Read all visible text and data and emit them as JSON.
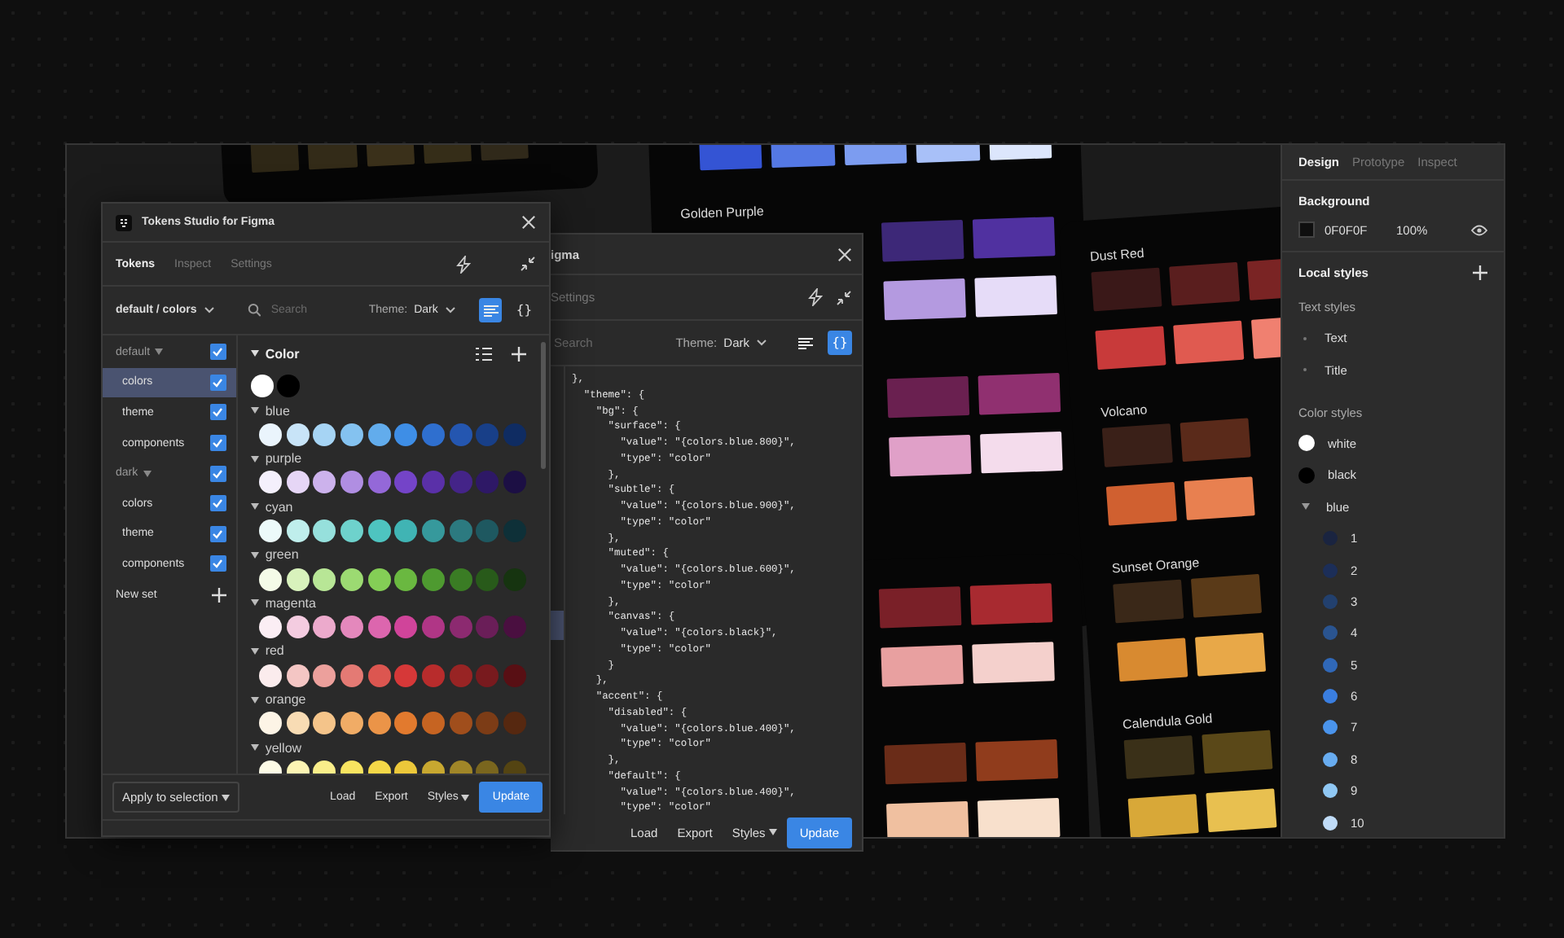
{
  "plugin": {
    "title": "Tokens Studio for Figma",
    "tabs": [
      {
        "label": "Tokens",
        "selected": true
      },
      {
        "label": "Inspect",
        "selected": false
      },
      {
        "label": "Settings",
        "selected": false
      }
    ],
    "set_picker": "default / colors",
    "search": {
      "placeholder": "Search"
    },
    "theme_label": "Theme:",
    "theme_value": "Dark",
    "view_buttons": [
      {
        "kind": "list",
        "selected": true
      },
      {
        "kind": "json",
        "label": "{}",
        "selected": false
      }
    ],
    "sets": [
      {
        "label": "default",
        "kind": "group",
        "checked": true,
        "selected": false
      },
      {
        "label": "colors",
        "kind": "set",
        "checked": true,
        "selected": true
      },
      {
        "label": "theme",
        "kind": "set",
        "checked": true,
        "selected": false
      },
      {
        "label": "components",
        "kind": "set",
        "checked": true,
        "selected": false
      },
      {
        "label": "dark",
        "kind": "group",
        "checked": true,
        "selected": false
      },
      {
        "label": "colors",
        "kind": "set",
        "checked": true,
        "selected": false
      },
      {
        "label": "theme",
        "kind": "set",
        "checked": true,
        "selected": false
      },
      {
        "label": "components",
        "kind": "set",
        "checked": true,
        "selected": false
      }
    ],
    "new_set": "New set",
    "tokens": {
      "title": "Color",
      "base": [
        {
          "color": "#ffffff"
        },
        {
          "color": "#000000"
        }
      ],
      "groups": [
        {
          "name": "blue",
          "swatches": [
            {
              "color": "#eaf4fc"
            },
            {
              "color": "#c8e4f8"
            },
            {
              "color": "#a6d4f4"
            },
            {
              "color": "#84c2f0"
            },
            {
              "color": "#62acec"
            },
            {
              "color": "#3e8ee6"
            },
            {
              "color": "#2f6fcf"
            },
            {
              "color": "#2456b0"
            },
            {
              "color": "#183f88"
            },
            {
              "color": "#0f2c62"
            }
          ]
        },
        {
          "name": "purple",
          "swatches": [
            {
              "color": "#f4f0fc"
            },
            {
              "color": "#e6d6f6"
            },
            {
              "color": "#ccb2ec"
            },
            {
              "color": "#b08ee2"
            },
            {
              "color": "#9468d8"
            },
            {
              "color": "#7444c8"
            },
            {
              "color": "#5a30a8"
            },
            {
              "color": "#442488"
            },
            {
              "color": "#2e1866"
            },
            {
              "color": "#1c0f44"
            }
          ]
        },
        {
          "name": "cyan",
          "swatches": [
            {
              "color": "#ecfafa"
            },
            {
              "color": "#bfeeec"
            },
            {
              "color": "#96e0dc"
            },
            {
              "color": "#6ed2cc"
            },
            {
              "color": "#4ec4c0"
            },
            {
              "color": "#40b4b4"
            },
            {
              "color": "#36999c"
            },
            {
              "color": "#2c7a80"
            },
            {
              "color": "#1e5860"
            },
            {
              "color": "#0e3038"
            }
          ]
        },
        {
          "name": "green",
          "swatches": [
            {
              "color": "#f4fbe8"
            },
            {
              "color": "#d8f2bc"
            },
            {
              "color": "#b8e696"
            },
            {
              "color": "#9cda72"
            },
            {
              "color": "#84ce56"
            },
            {
              "color": "#6ab840"
            },
            {
              "color": "#4e9a30"
            },
            {
              "color": "#3a7c24"
            },
            {
              "color": "#285a1a"
            },
            {
              "color": "#163410"
            }
          ]
        },
        {
          "name": "magenta",
          "swatches": [
            {
              "color": "#fbeef4"
            },
            {
              "color": "#f4cce0"
            },
            {
              "color": "#ecaacc"
            },
            {
              "color": "#e488bc"
            },
            {
              "color": "#dc66ae"
            },
            {
              "color": "#d0449a"
            },
            {
              "color": "#b03686"
            },
            {
              "color": "#8c2a70"
            },
            {
              "color": "#6a1e58"
            },
            {
              "color": "#4a0f40"
            }
          ]
        },
        {
          "name": "red",
          "swatches": [
            {
              "color": "#fbeced"
            },
            {
              "color": "#f4c6c4"
            },
            {
              "color": "#eca09c"
            },
            {
              "color": "#e47a74"
            },
            {
              "color": "#dc5650"
            },
            {
              "color": "#d63838"
            },
            {
              "color": "#b82c2c"
            },
            {
              "color": "#982424"
            },
            {
              "color": "#781a1e"
            },
            {
              "color": "#580f14"
            }
          ]
        },
        {
          "name": "orange",
          "swatches": [
            {
              "color": "#fdf4e6"
            },
            {
              "color": "#f8dcb4"
            },
            {
              "color": "#f4c48a"
            },
            {
              "color": "#f0ac66"
            },
            {
              "color": "#eb9448"
            },
            {
              "color": "#e27a2e"
            },
            {
              "color": "#c66422"
            },
            {
              "color": "#a04e1c"
            },
            {
              "color": "#7c3c16"
            },
            {
              "color": "#562810"
            }
          ]
        },
        {
          "name": "yellow",
          "swatches": [
            {
              "color": "#fdfbe6"
            },
            {
              "color": "#fcf4b4"
            },
            {
              "color": "#faee8a"
            },
            {
              "color": "#f8e460"
            },
            {
              "color": "#f4d848"
            },
            {
              "color": "#ecc83a"
            },
            {
              "color": "#c8a830"
            },
            {
              "color": "#a08628"
            },
            {
              "color": "#7a661e"
            },
            {
              "color": "#544412"
            }
          ]
        }
      ]
    },
    "footer": {
      "apply": "Apply to selection",
      "buttons": [
        {
          "label": "Load",
          "kind": "plain"
        },
        {
          "label": "Export",
          "kind": "plain"
        },
        {
          "label": "Styles",
          "kind": "menu"
        },
        {
          "label": "Update",
          "kind": "primary"
        }
      ]
    }
  },
  "json_plugin": {
    "title": "igma",
    "tab": "Settings",
    "search": {
      "placeholder": "Search"
    },
    "theme_label": "Theme:",
    "theme_value": "Dark",
    "view_buttons": [
      {
        "kind": "list",
        "selected": false
      },
      {
        "kind": "json",
        "label": "{}",
        "selected": true
      }
    ],
    "code": [
      "},",
      "  \"theme\": {",
      "    \"bg\": {",
      "      \"surface\": {",
      "        \"value\": \"{colors.blue.800}\",",
      "        \"type\": \"color\"",
      "      },",
      "      \"subtle\": {",
      "        \"value\": \"{colors.blue.900}\",",
      "        \"type\": \"color\"",
      "      },",
      "      \"muted\": {",
      "        \"value\": \"{colors.blue.600}\",",
      "        \"type\": \"color\"",
      "      },",
      "      \"canvas\": {",
      "        \"value\": \"{colors.black}\",",
      "        \"type\": \"color\"",
      "      }",
      "    },",
      "    \"accent\": {",
      "      \"disabled\": {",
      "        \"value\": \"{colors.blue.400}\",",
      "        \"type\": \"color\"",
      "      },",
      "      \"default\": {",
      "        \"value\": \"{colors.blue.400}\",",
      "        \"type\": \"color\""
    ],
    "footer": [
      {
        "label": "Load",
        "kind": "plain"
      },
      {
        "label": "Export",
        "kind": "plain"
      },
      {
        "label": "Styles",
        "kind": "menu"
      },
      {
        "label": "Update",
        "kind": "primary"
      }
    ]
  },
  "canvas": {
    "cards": [
      {
        "sections": [
          {
            "rows": [
              [
                {
                  "color": "#2e2716"
                },
                {
                  "color": "#332b18"
                },
                {
                  "color": "#3a301a"
                },
                {
                  "color": "#352d18"
                },
                {
                  "color": "#30291a"
                }
              ]
            ]
          }
        ]
      },
      {
        "sections": [
          {
            "rows": [
              [
                {
                  "color": "#3454d4"
                },
                {
                  "color": "#5478e4"
                },
                {
                  "color": "#7c9cf0"
                },
                {
                  "color": "#a8c0f8"
                },
                {
                  "color": "#dce6fc"
                }
              ]
            ]
          },
          {
            "title": "Golden Purple",
            "rows": [
              [
                {
                  "color": "#3d2878"
                },
                {
                  "color": "#5031a0"
                }
              ],
              [
                {
                  "color": "#b49ae0"
                },
                {
                  "color": "#e6dcf8"
                }
              ]
            ]
          },
          {
            "rows": [
              [
                {
                  "color": "#6a2050"
                },
                {
                  "color": "#903070"
                }
              ],
              [
                {
                  "color": "#e0a0c8"
                },
                {
                  "color": "#f4dcec"
                }
              ]
            ]
          }
        ]
      },
      {
        "sections": [
          {
            "rows": [
              [
                {
                  "color": "#7a2028"
                },
                {
                  "color": "#a82a30"
                }
              ],
              [
                {
                  "color": "#e8a0a0"
                },
                {
                  "color": "#f4d0cc"
                }
              ]
            ]
          },
          {
            "rows": [
              [
                {
                  "color": "#6a2c18"
                },
                {
                  "color": "#903c1c"
                }
              ],
              [
                {
                  "color": "#f0c0a0"
                },
                {
                  "color": "#f8e0cc"
                }
              ]
            ]
          }
        ]
      },
      {
        "sections": [
          {
            "title": "Dust Red",
            "rows": [
              [
                {
                  "color": "#3a1818"
                },
                {
                  "color": "#5a1e1e"
                },
                {
                  "color": "#7a2424"
                }
              ],
              [
                {
                  "color": "#c83a3a"
                },
                {
                  "color": "#e05a50"
                },
                {
                  "color": "#f08070"
                }
              ]
            ]
          },
          {
            "title": "Volcano",
            "rows": [
              [
                {
                  "color": "#3a2018"
                },
                {
                  "color": "#5a2a1a"
                }
              ],
              [
                {
                  "color": "#d06030"
                },
                {
                  "color": "#e88050"
                }
              ]
            ]
          },
          {
            "title": "Sunset Orange",
            "rows": [
              [
                {
                  "color": "#3a2818"
                },
                {
                  "color": "#5a3a18"
                }
              ],
              [
                {
                  "color": "#d88a30"
                },
                {
                  "color": "#e8a848"
                }
              ]
            ]
          },
          {
            "title": "Calendula Gold",
            "rows": [
              [
                {
                  "color": "#3a3018"
                },
                {
                  "color": "#5a4818"
                }
              ],
              [
                {
                  "color": "#d8a838"
                },
                {
                  "color": "#e8c050"
                }
              ]
            ]
          }
        ]
      }
    ]
  },
  "design_panel": {
    "tabs": [
      {
        "label": "Design",
        "selected": true
      },
      {
        "label": "Prototype",
        "selected": false
      },
      {
        "label": "Inspect",
        "selected": false
      }
    ],
    "background": {
      "title": "Background",
      "color": "#0f0f0f",
      "hex": "0F0F0F",
      "opacity": "100%"
    },
    "local_styles": "Local styles",
    "text_styles": {
      "title": "Text styles",
      "items": [
        "Text",
        "Title"
      ]
    },
    "color_styles": {
      "title": "Color styles",
      "items": [
        {
          "kind": "style",
          "name": "white",
          "color": "#ffffff"
        },
        {
          "kind": "style",
          "name": "black",
          "color": "#000000"
        },
        {
          "kind": "group",
          "name": "blue",
          "expanded": true,
          "children": [
            {
              "name": "1",
              "color": "#1a2440"
            },
            {
              "name": "2",
              "color": "#1c2e58"
            },
            {
              "name": "3",
              "color": "#22406e"
            },
            {
              "name": "4",
              "color": "#2a5490"
            },
            {
              "name": "5",
              "color": "#3068b8"
            },
            {
              "name": "6",
              "color": "#3a7ee0"
            },
            {
              "name": "7",
              "color": "#4a94ec"
            },
            {
              "name": "8",
              "color": "#68acf0"
            },
            {
              "name": "9",
              "color": "#90c8f4"
            },
            {
              "name": "10",
              "color": "#c0dcf8"
            }
          ]
        }
      ]
    }
  }
}
